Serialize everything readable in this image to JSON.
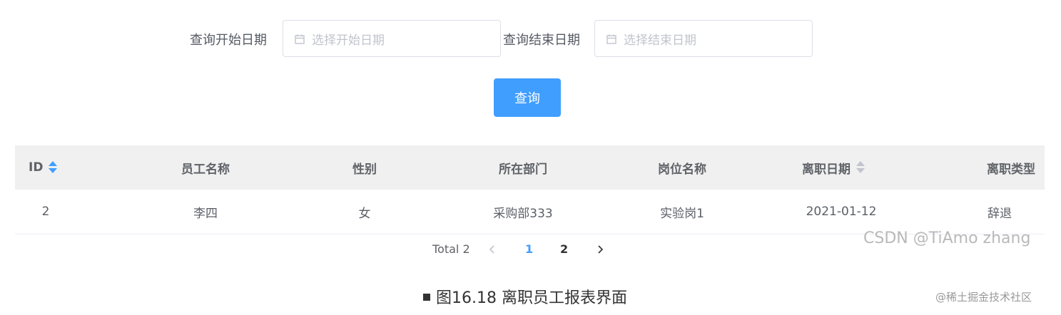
{
  "filters": {
    "start_label": "查询开始日期",
    "start_placeholder": "选择开始日期",
    "end_label": "查询结束日期",
    "end_placeholder": "选择结束日期",
    "query_button": "查询"
  },
  "table": {
    "headers": [
      "ID",
      "员工名称",
      "性别",
      "所在部门",
      "岗位名称",
      "离职日期",
      "离职类型"
    ],
    "rows": [
      [
        "2",
        "李四",
        "女",
        "采购部333",
        "实验岗1",
        "2021-01-12",
        "辞退"
      ]
    ]
  },
  "pagination": {
    "total": "Total 2",
    "pages": [
      "1",
      "2"
    ],
    "current_page": "1",
    "active_color": "#409eff"
  },
  "watermark": "CSDN @TiAmo zhang",
  "caption": "图16.18 离职员工报表界面",
  "site_mark": "@稀土掘金技术社区",
  "colors": {
    "primary": "#409eff",
    "header_bg": "#f0f0f0"
  }
}
